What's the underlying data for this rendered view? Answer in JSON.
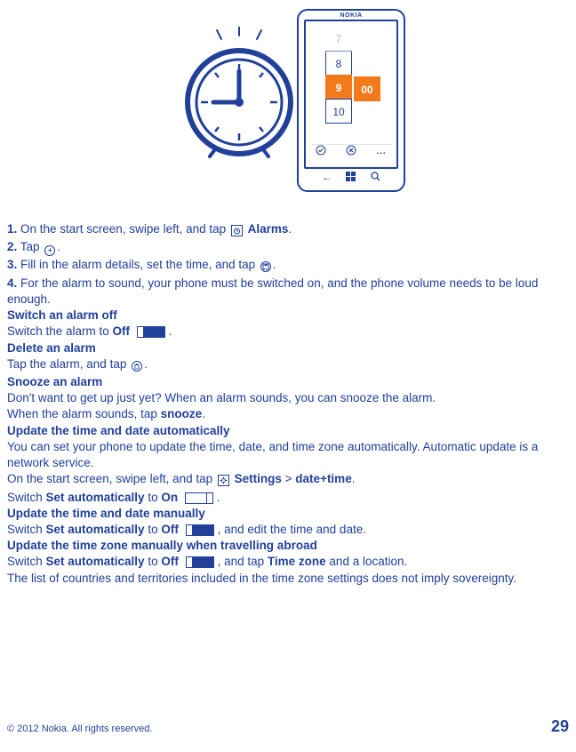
{
  "illustration": {
    "phone_brand": "NOKIA",
    "hours": [
      "7",
      "8",
      "9",
      "10"
    ],
    "minutes": "00",
    "dots": "..."
  },
  "steps": {
    "s1_num": "1.",
    "s1_a": " On the start screen, swipe left, and tap ",
    "s1_b": "Alarms",
    "s1_c": ".",
    "s2_num": "2.",
    "s2_a": " Tap ",
    "s2_b": ".",
    "s3_num": "3.",
    "s3_a": " Fill in the alarm details, set the time, and tap ",
    "s3_b": ".",
    "s4_num": "4.",
    "s4_a": " For the alarm to sound, your phone must be switched on, and the phone volume needs to be loud enough."
  },
  "switchOff": {
    "head": "Switch an alarm off",
    "a": "Switch the alarm to ",
    "b": "Off",
    "c": "."
  },
  "deleteAlarm": {
    "head": "Delete an alarm",
    "a": "Tap the alarm, and tap ",
    "b": "."
  },
  "snooze": {
    "head": "Snooze an alarm",
    "a": "Don't want to get up just yet? When an alarm sounds, you can snooze the alarm.",
    "b": "When the alarm sounds, tap ",
    "c": "snooze",
    "d": "."
  },
  "autoUpdate": {
    "head": "Update the time and date automatically",
    "a": "You can set your phone to update the time, date, and time zone automatically. Automatic update is a network service.",
    "b1": "On the start screen, swipe left, and tap ",
    "b2": "Settings",
    "b3": " > ",
    "b4": "date+time",
    "b5": ".",
    "c1": "Switch ",
    "c2": "Set automatically",
    "c3": " to ",
    "c4": "On",
    "c5": "."
  },
  "manualUpdate": {
    "head": "Update the time and date manually",
    "a1": "Switch ",
    "a2": "Set automatically",
    "a3": " to ",
    "a4": "Off",
    "a5": ", and edit the time and date."
  },
  "tzUpdate": {
    "head": "Update the time zone manually when travelling abroad",
    "a1": "Switch ",
    "a2": "Set automatically",
    "a3": " to ",
    "a4": "Off",
    "a5": ", and tap ",
    "a6": "Time zone",
    "a7": " and a location."
  },
  "note": "The list of countries and territories included in the time zone settings does not imply sovereignty.",
  "footer": {
    "copyright": "© 2012 Nokia. All rights reserved.",
    "page": "29"
  }
}
